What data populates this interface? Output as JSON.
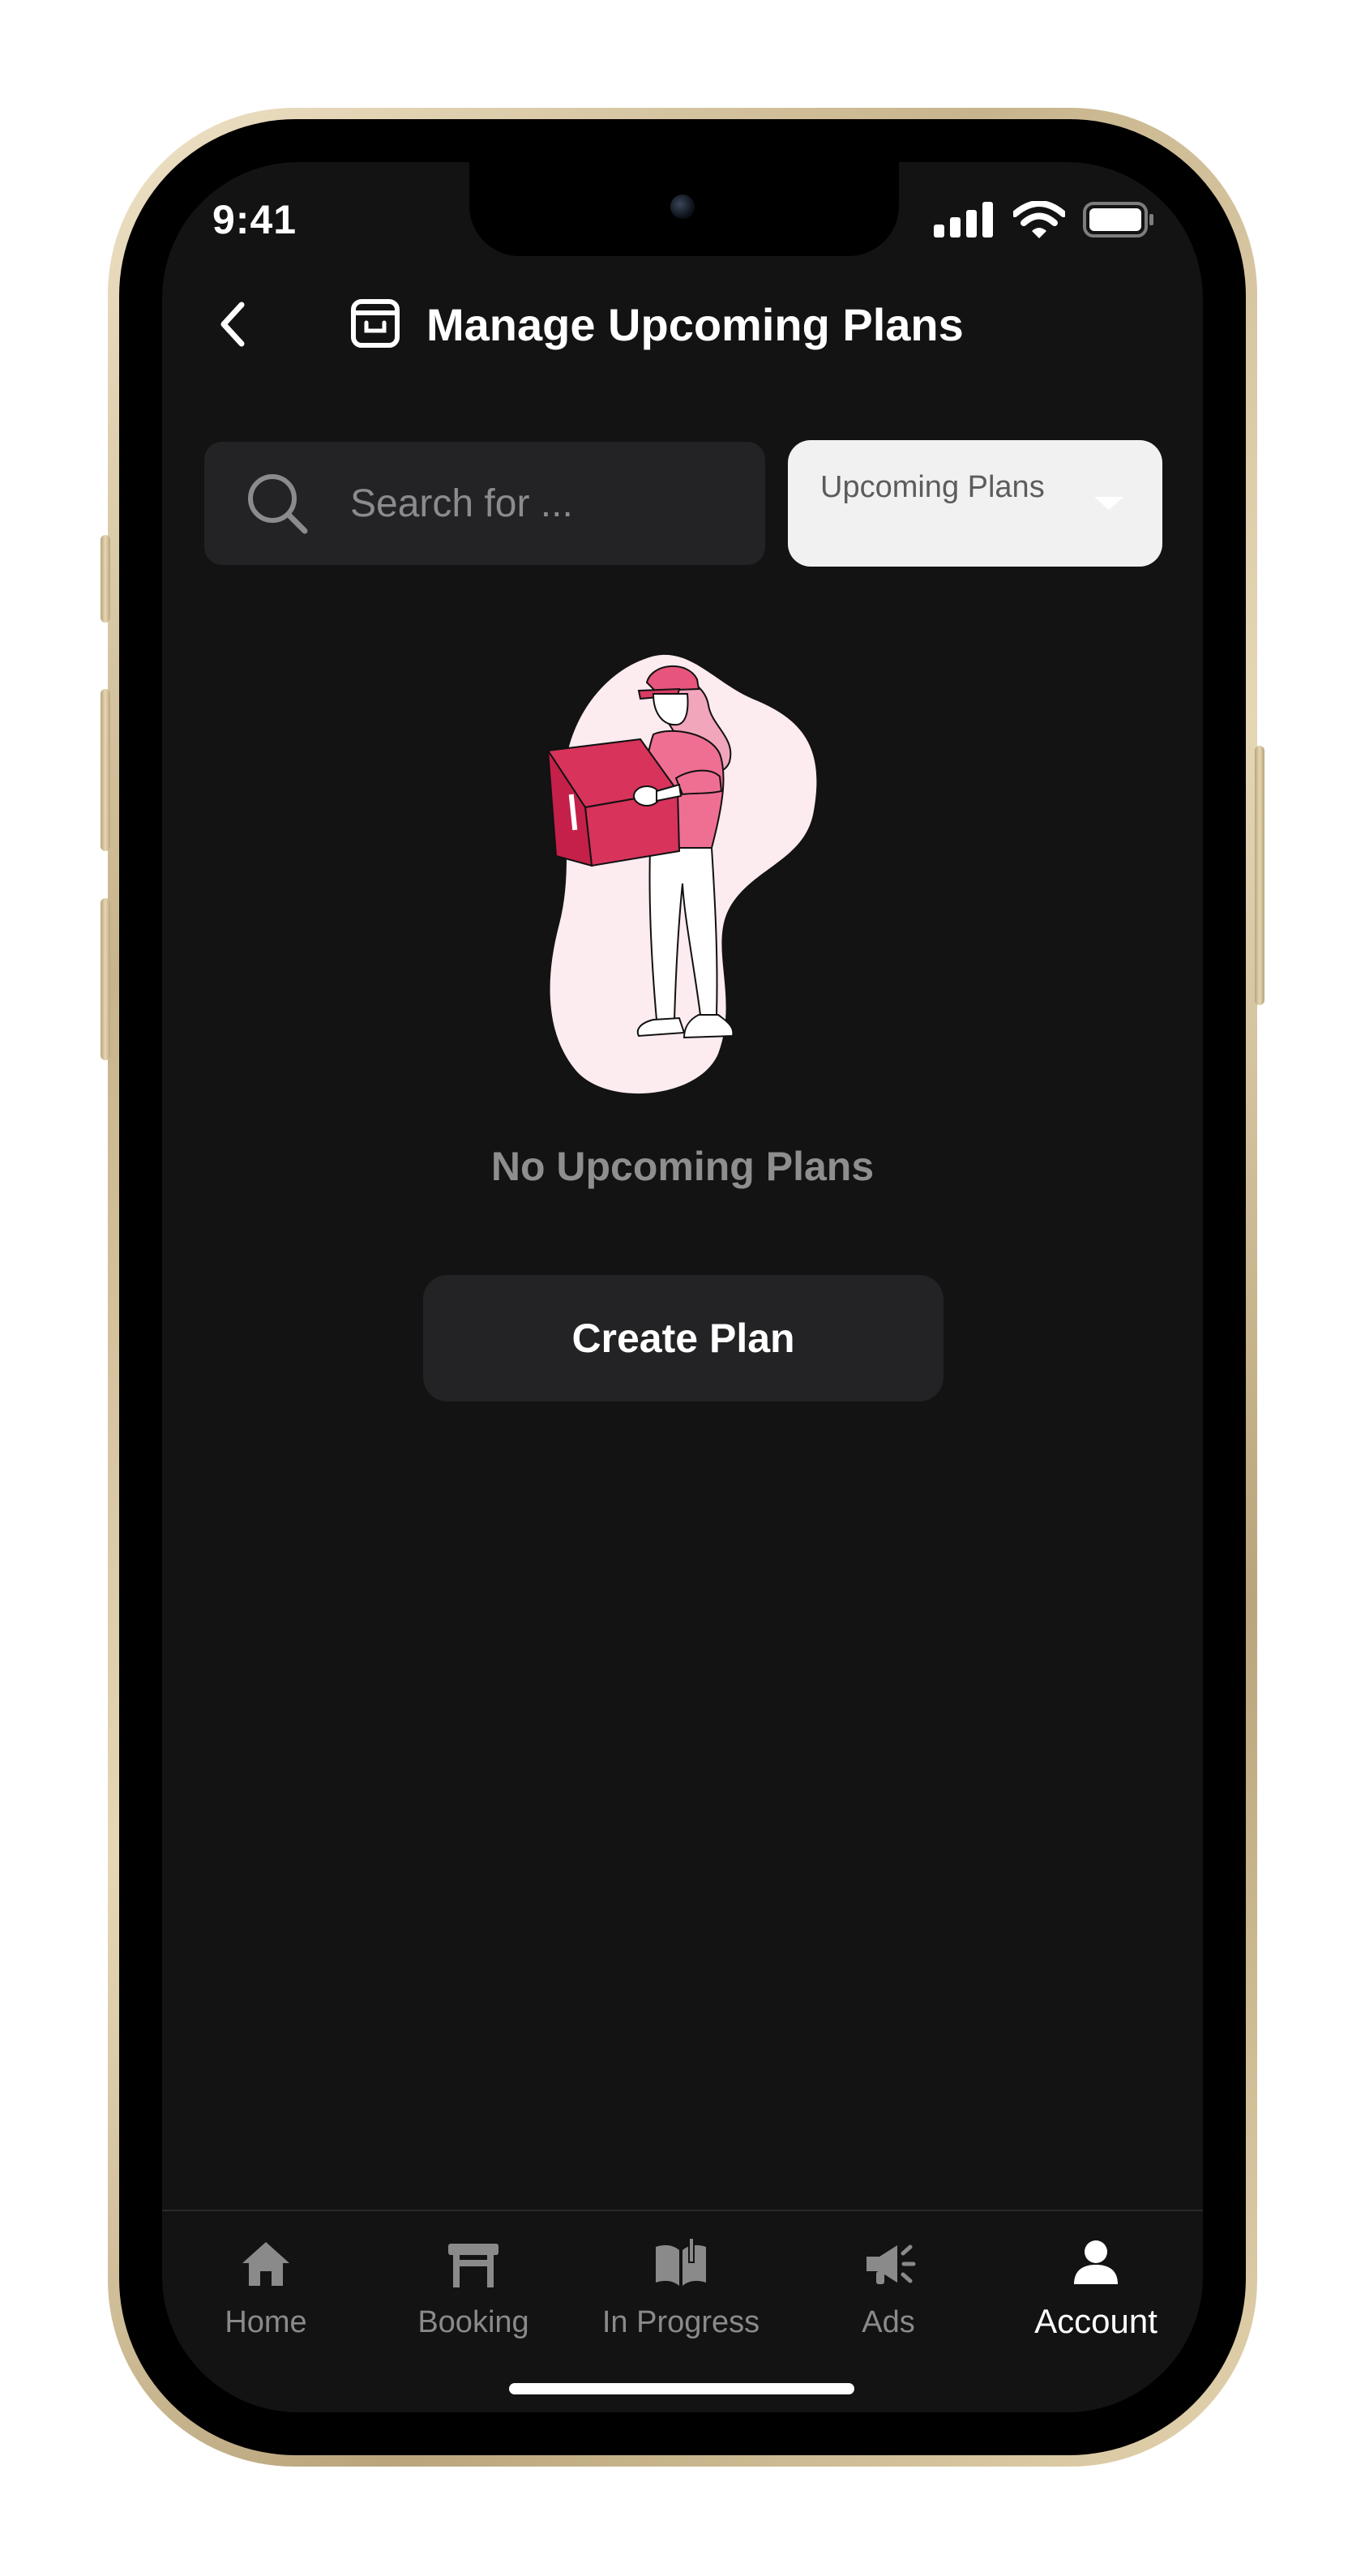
{
  "status_bar": {
    "time": "9:41",
    "icons": [
      "signal-icon",
      "wifi-icon",
      "battery-icon"
    ]
  },
  "header": {
    "title": "Manage Upcoming Plans",
    "back_icon": "chevron-left-icon",
    "title_icon": "archive-box-icon"
  },
  "search": {
    "placeholder": "Search for ...",
    "value": ""
  },
  "filter": {
    "selected": "Upcoming Plans"
  },
  "empty_state": {
    "illustration": "person-holding-box-illustration",
    "message": "No Upcoming Plans",
    "button_label": "Create Plan"
  },
  "tab_bar": {
    "items": [
      {
        "label": "Home",
        "icon": "home-icon",
        "active": false
      },
      {
        "label": "Booking",
        "icon": "table-icon",
        "active": false
      },
      {
        "label": "In Progress",
        "icon": "book-icon",
        "active": false
      },
      {
        "label": "Ads",
        "icon": "megaphone-icon",
        "active": false
      },
      {
        "label": "Account",
        "icon": "user-icon",
        "active": true
      }
    ]
  },
  "colors": {
    "screen_background": "#131313",
    "card_background": "#232325",
    "dropdown_background": "#f1f1f1",
    "illustration_accent": "#e8557c"
  }
}
